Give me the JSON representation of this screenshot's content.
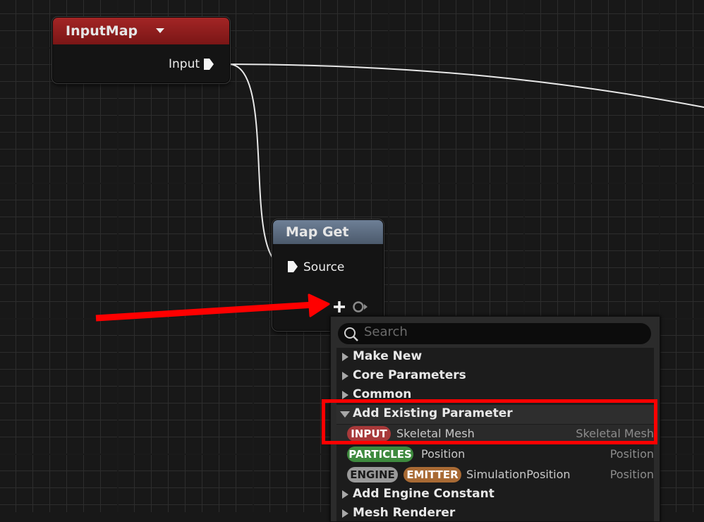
{
  "nodes": {
    "input_map": {
      "title": "InputMap",
      "output_label": "Input",
      "header_color": "#8e1c1c"
    },
    "map_get": {
      "title": "Map Get",
      "input_label": "Source",
      "header_color": "#5d6c80"
    }
  },
  "menu": {
    "search_placeholder": "Search",
    "categories": {
      "make_new": "Make New",
      "core_parameters": "Core Parameters",
      "common": "Common",
      "add_existing": "Add Existing Parameter",
      "add_engine_constant": "Add Engine Constant",
      "mesh_renderer": "Mesh Renderer"
    },
    "params": [
      {
        "tags": [
          "INPUT"
        ],
        "name": "Skeletal Mesh",
        "type": "Skeletal Mesh"
      },
      {
        "tags": [
          "PARTICLES"
        ],
        "name": "Position",
        "type": "Position"
      },
      {
        "tags": [
          "ENGINE",
          "EMITTER"
        ],
        "name": "SimulationPosition",
        "type": "Position"
      }
    ]
  },
  "colors": {
    "input_tag": "#a8393a",
    "particles_tag": "#3e8a3e",
    "engine_tag": "#9a9a9a",
    "emitter_tag": "#a86a34",
    "annotation": "#ff0000"
  }
}
